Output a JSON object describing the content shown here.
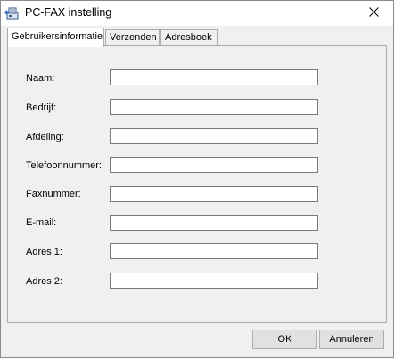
{
  "window": {
    "title": "PC-FAX instelling",
    "icon": "fax-icon",
    "close_icon": "close-icon"
  },
  "tabs": [
    {
      "label": "Gebruikersinformatie",
      "active": true
    },
    {
      "label": "Verzenden",
      "active": false
    },
    {
      "label": "Adresboek",
      "active": false
    }
  ],
  "form": {
    "fields": [
      {
        "label": "Naam:",
        "value": ""
      },
      {
        "label": "Bedrijf:",
        "value": ""
      },
      {
        "label": "Afdeling:",
        "value": ""
      },
      {
        "label": "Telefoonnummer:",
        "value": ""
      },
      {
        "label": "Faxnummer:",
        "value": ""
      },
      {
        "label": "E-mail:",
        "value": ""
      },
      {
        "label": "Adres 1:",
        "value": ""
      },
      {
        "label": "Adres 2:",
        "value": ""
      }
    ]
  },
  "buttons": {
    "ok": "OK",
    "cancel": "Annuleren"
  }
}
